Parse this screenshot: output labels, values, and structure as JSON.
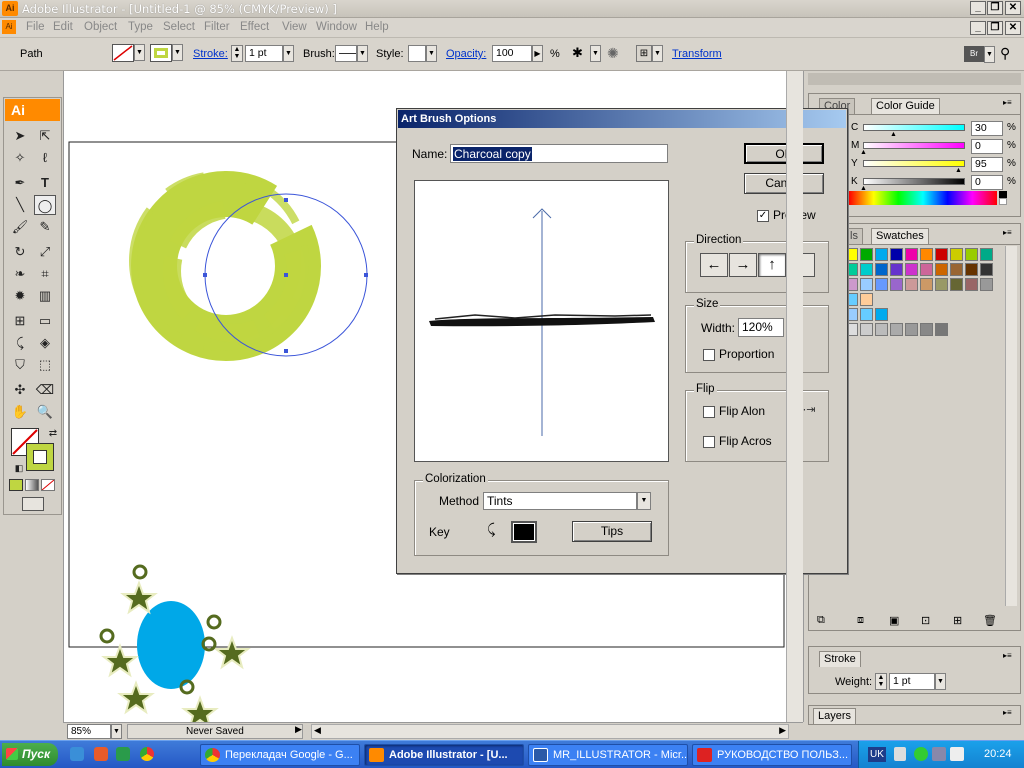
{
  "window": {
    "title": "Adobe Illustrator - [Untitled-1 @ 85% (CMYK/Preview) ]",
    "logo": "Ai",
    "min": "_",
    "restore": "❐",
    "close": "✕"
  },
  "menu": [
    "File",
    "Edit",
    "Object",
    "Type",
    "Select",
    "Filter",
    "Effect",
    "View",
    "Window",
    "Help"
  ],
  "control": {
    "object_type": "Path",
    "stroke_label": "Stroke:",
    "stroke_weight": "1 pt",
    "brush_label": "Brush:",
    "style_label": "Style:",
    "opacity_label": "Opacity:",
    "opacity_value": "100",
    "percent": "%",
    "transform_label": "Transform"
  },
  "toolbox": {
    "badge": "Ai"
  },
  "dialog": {
    "title": "Art Brush Options",
    "name_label": "Name:",
    "name_value": "Charcoal copy",
    "ok": "OK",
    "cancel": "Cancel",
    "preview_label": "Preview",
    "preview_checked": true,
    "direction_label": "Direction",
    "direction_buttons": [
      "←",
      "→",
      "↑",
      "↓"
    ],
    "size_label": "Size",
    "width_label": "Width:",
    "width_value": "120%",
    "proportion_label": "Proportion",
    "flip_label": "Flip",
    "flip_along": "Flip Alon",
    "flip_across": "Flip Acros",
    "colorization_label": "Colorization",
    "method_label": "Method",
    "method_value": "Tints",
    "key_label": "Key",
    "tips": "Tips"
  },
  "color_panel": {
    "tabs": [
      "Color",
      "Color Guide"
    ],
    "channels": [
      {
        "label": "C",
        "value": "30",
        "unit": "%",
        "level": 0.3
      },
      {
        "label": "M",
        "value": "0",
        "unit": "%",
        "level": 0
      },
      {
        "label": "Y",
        "value": "95",
        "unit": "%",
        "level": 0.95
      },
      {
        "label": "K",
        "value": "0",
        "unit": "%",
        "level": 0
      }
    ]
  },
  "swatches_panel": {
    "tabs": [
      "ls",
      "Swatches"
    ]
  },
  "stroke_panel": {
    "tab": "Stroke",
    "weight_label": "Weight:",
    "weight_value": "1 pt"
  },
  "layers_panel": {
    "tab": "Layers"
  },
  "status": {
    "zoom": "85%",
    "info": "Never Saved"
  },
  "taskbar": {
    "start": "Пуск",
    "tasks": [
      {
        "label": "Перекладач Google - G...",
        "active": false
      },
      {
        "label": "Adobe Illustrator - [U...",
        "active": true
      },
      {
        "label": "MR_ILLUSTRATOR - Micr...",
        "active": false
      },
      {
        "label": "РУКОВОДСТВО ПОЛЬЗ...",
        "active": false
      }
    ],
    "lang": "UK",
    "time": "20:24"
  },
  "colors": {
    "lime": "#bfd641",
    "cyan": "#00a8e8",
    "olive": "#556b1f",
    "accent": "#0a246a"
  }
}
